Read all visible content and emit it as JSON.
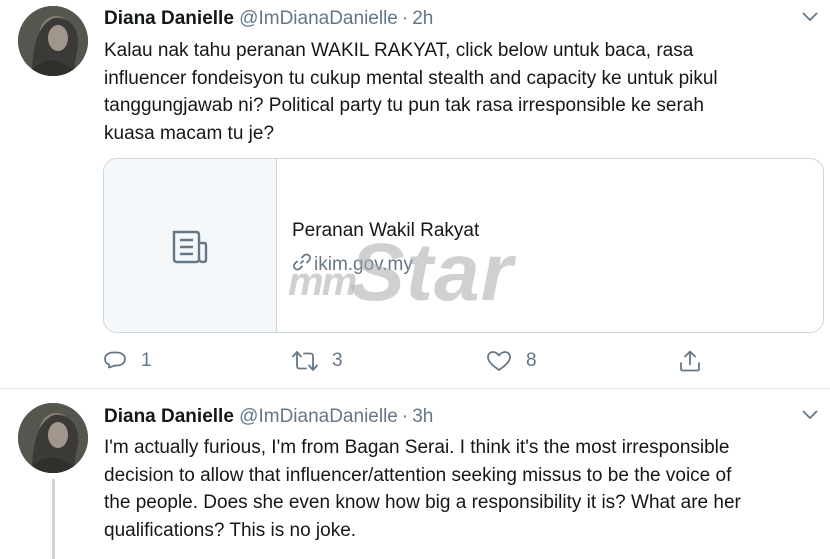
{
  "tweets": [
    {
      "name": "Diana Danielle",
      "handle": "@ImDianaDanielle",
      "separator": "·",
      "time": "2h",
      "lines": [
        "Kalau nak tahu peranan WAKIL RAKYAT, click below untuk baca, rasa",
        "influencer fondeisyon tu cukup mental stealth and capacity ke untuk pikul",
        "tanggungjawab ni? Political party tu pun tak rasa irresponsible ke serah",
        "kuasa macam tu je?"
      ],
      "card": {
        "title": "Peranan Wakil Rakyat",
        "domain": "ikim.gov.my",
        "thumb_icon": "document-icon",
        "domain_icon": "link-icon"
      },
      "actions": {
        "replies": "1",
        "retweets": "3",
        "likes": "8",
        "reply_icon": "reply-icon",
        "retweet_icon": "retweet-icon",
        "like_icon": "heart-icon",
        "share_icon": "share-icon"
      }
    },
    {
      "name": "Diana Danielle",
      "handle": "@ImDianaDanielle",
      "separator": "·",
      "time": "3h",
      "lines": [
        "I'm actually furious, I'm from Bagan Serai. I think it's the most irresponsible",
        "decision to allow that influencer/attention seeking missus to be the voice of",
        "the people. Does she even know how big a responsibility it is? What are her",
        "qualifications? This is no joke."
      ]
    }
  ],
  "watermark": {
    "prefix": "mm",
    "text": "Star"
  },
  "colors": {
    "text": "#14171a",
    "secondary": "#657786",
    "border": "#ccd6dd",
    "card_thumb_bg": "#f5f8fa"
  }
}
